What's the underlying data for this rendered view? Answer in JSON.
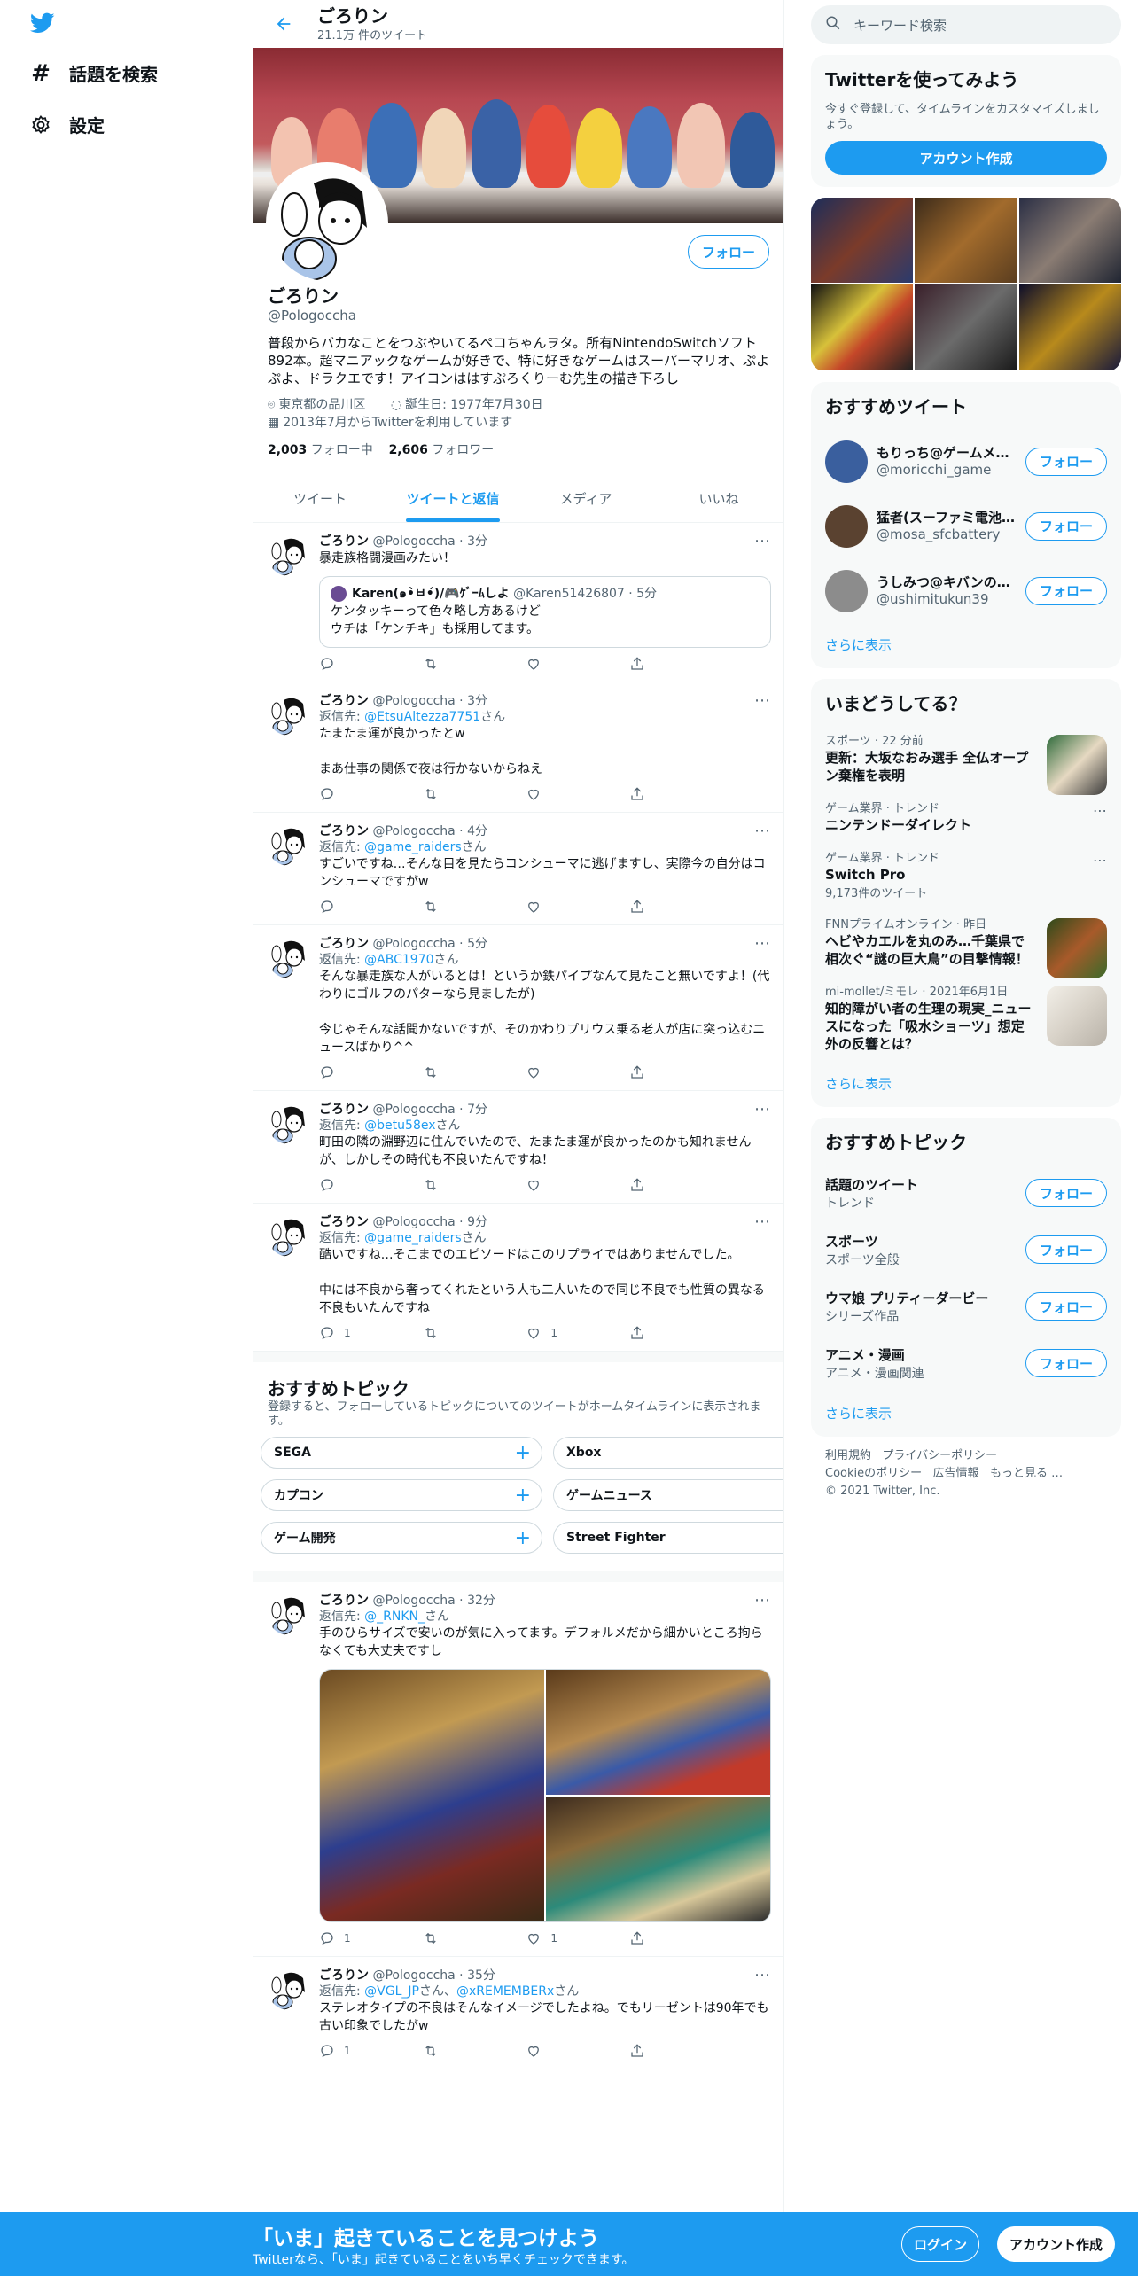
{
  "nav": {
    "explore_label": "話題を検索",
    "settings_label": "設定"
  },
  "header": {
    "name": "ごろりン",
    "tweet_count": "21.1万 件のツイート"
  },
  "profile": {
    "follow_label": "フォロー",
    "name": "ごろりン",
    "handle": "@Pologoccha",
    "bio": "普段からバカなことをつぶやいてるペコちゃんヲタ。所有NintendoSwitchソフト892本。超マニアックなゲームが好きで、特に好きなゲームはスーパーマリオ、ぷよぷよ、ドラクエです！アイコンははすぷろくりーむ先生の描き下ろし",
    "location": "東京都の品川区",
    "birthday": "誕生日: 1977年7月30日",
    "joined": "2013年7月からTwitterを利用しています",
    "following_count": "2,003",
    "following_label": "フォロー中",
    "followers_count": "2,606",
    "followers_label": "フォロワー"
  },
  "tabs": [
    {
      "label": "ツイート"
    },
    {
      "label": "ツイートと返信"
    },
    {
      "label": "メディア"
    },
    {
      "label": "いいね"
    }
  ],
  "tweets": [
    {
      "name": "ごろりン",
      "meta": "@Pologoccha · 3分",
      "text": "暴走族格闘漫画みたい！",
      "quote": {
        "name": "Karen(๑•̀ㅂ•́)/🎮ｹﾞｰﾑしよ",
        "meta": "@Karen51426807 · 5分",
        "text": "ケンタッキーって色々略し方あるけど\nウチは「ケンチキ」も採用してます。"
      }
    },
    {
      "name": "ごろりン",
      "meta": "@Pologoccha · 3分",
      "reply_prefix": "返信先: ",
      "reply_to": "@EtsuAltezza7751",
      "reply_suffix": "さん",
      "text": "たまたま運が良かったとw\n\nまあ仕事の関係で夜は行かないからねえ"
    },
    {
      "name": "ごろりン",
      "meta": "@Pologoccha · 4分",
      "reply_prefix": "返信先: ",
      "reply_to": "@game_raiders",
      "reply_suffix": "さん",
      "text": "すごいですね…そんな目を見たらコンシューマに逃げますし、実際今の自分はコンシューマですがw"
    },
    {
      "name": "ごろりン",
      "meta": "@Pologoccha · 5分",
      "reply_prefix": "返信先: ",
      "reply_to": "@ABC1970",
      "reply_suffix": "さん",
      "text": "そんな暴走族な人がいるとは！というか鉄パイプなんて見たこと無いですよ！(代わりにゴルフのパターなら見ましたが)\n\n今じゃそんな話聞かないですが、そのかわりプリウス乗る老人が店に突っ込むニュースばかり^^"
    },
    {
      "name": "ごろりン",
      "meta": "@Pologoccha · 7分",
      "reply_prefix": "返信先: ",
      "reply_to": "@betu58ex",
      "reply_suffix": "さん",
      "text": "町田の隣の淵野辺に住んでいたので、たまたま運が良かったのかも知れませんが、しかしその時代も不良いたんですね！"
    },
    {
      "name": "ごろりン",
      "meta": "@Pologoccha · 9分",
      "reply_prefix": "返信先: ",
      "reply_to": "@game_raiders",
      "reply_suffix": "さん",
      "text": "酷いですね…そこまでのエピソードはこのリプライではありませんでした。\n\n中には不良から奢ってくれたという人も二人いたので同じ不良でも性質の異なる不良もいたんですね",
      "reply_count": "1",
      "like_count": "1"
    }
  ],
  "topics": {
    "title": "おすすめトピック",
    "desc": "登録すると、フォローしているトピックについてのツイートがホームタイムラインに表示されます。",
    "chips": [
      "SEGA",
      "Xbox",
      "カプコン",
      "ゲームニュース",
      "ゲーム開発",
      "Street Fighter"
    ]
  },
  "tweets2": [
    {
      "name": "ごろりン",
      "meta": "@Pologoccha · 32分",
      "reply_prefix": "返信先: ",
      "reply_to": "@_RNKN_",
      "reply_suffix": "さん",
      "text": "手のひらサイズで安いのが気に入ってます。デフォルメだから細かいところ拘らなくても大丈夫ですし",
      "reply_count": "1",
      "like_count": "1"
    },
    {
      "name": "ごろりン",
      "meta": "@Pologoccha · 35分",
      "reply_prefix": "返信先: ",
      "reply_to": "@VGL_JP",
      "reply_mid": "さん、",
      "reply_to2": "@xREMEMBERx",
      "reply_suffix": "さん",
      "text": "ステレオタイプの不良はそんなイメージでしたよね。でもリーゼントは90年でも古い印象でしたがw",
      "reply_count": "1"
    }
  ],
  "right": {
    "search_placeholder": "キーワード検索",
    "signup": {
      "title": "Twitterを使ってみよう",
      "sub": "今すぐ登録して、タイムラインをカスタマイズしましょう。",
      "button": "アカウント作成"
    },
    "who": {
      "title": "おすすめツイート",
      "users": [
        {
          "name": "もりっち@ゲームメ…",
          "handle": "@moricchi_game",
          "color": "#3a5f9e"
        },
        {
          "name": "猛者(スーファミ電池…",
          "handle": "@mosa_sfcbattery",
          "color": "#5a4230"
        },
        {
          "name": "うしみつ@キバンの…",
          "handle": "@ushimitukun39",
          "color": "#8c8c8c"
        }
      ],
      "follow_label": "フォロー",
      "more": "さらに表示"
    },
    "trends": {
      "title": "いまどうしてる？",
      "items": [
        {
          "meta": "スポーツ · 22 分前",
          "title": "更新：大坂なおみ選手 全仏オープン棄権を表明",
          "count": ""
        },
        {
          "meta": "ゲーム業界 · トレンド",
          "title": "ニンテンドーダイレクト",
          "count": ""
        },
        {
          "meta": "ゲーム業界 · トレンド",
          "title": "Switch Pro",
          "count": "9,173件のツイート"
        },
        {
          "meta": "FNNプライムオンライン · 昨日",
          "title": "ヘビやカエルを丸のみ…千葉県で相次ぐ“謎の巨大鳥”の目撃情報！",
          "count": ""
        },
        {
          "meta": "mi-mollet/ミモレ · 2021年6月1日",
          "title": "知的障がい者の生理の現実_ニュースになった「吸水ショーツ」想定外の反響とは？",
          "count": ""
        }
      ],
      "more": "さらに表示"
    },
    "topics": {
      "title": "おすすめトピック",
      "items": [
        {
          "title": "話題のツイート",
          "sub": "トレンド"
        },
        {
          "title": "スポーツ",
          "sub": "スポーツ全般"
        },
        {
          "title": "ウマ娘 プリティーダービー",
          "sub": "シリーズ作品"
        },
        {
          "title": "アニメ・漫画",
          "sub": "アニメ・漫画関連"
        }
      ],
      "follow_label": "フォロー",
      "more": "さらに表示"
    },
    "footer": {
      "l1": "利用規約",
      "l2": "プライバシーポリシー",
      "l3": "Cookieのポリシー",
      "l4": "広告情報",
      "l5": "もっと見る …",
      "copy": "© 2021 Twitter, Inc."
    }
  },
  "bottom_bar": {
    "title": "「いま」起きていることを見つけよう",
    "sub": "Twitterなら、「いま」起きていることをいち早くチェックできます。",
    "login": "ログイン",
    "signup": "アカウント作成"
  },
  "colors": {
    "accent": "#1d9bf0",
    "bottom_bar": "#1d9bf0"
  }
}
